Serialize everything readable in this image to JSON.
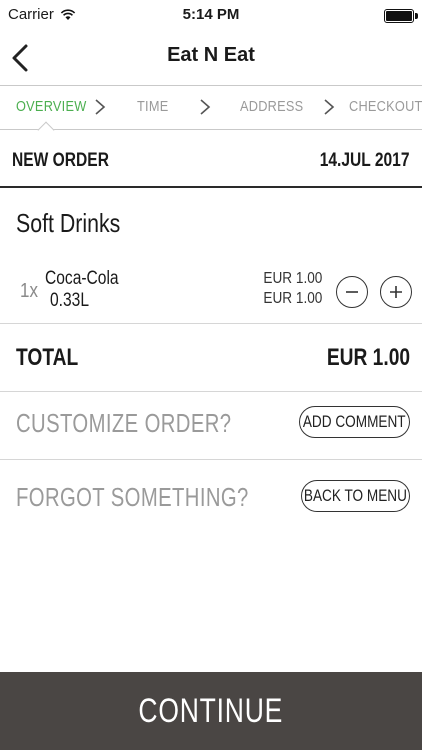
{
  "status_bar": {
    "carrier": "Carrier",
    "time": "5:14 PM",
    "battery_level": 1.0
  },
  "nav": {
    "title": "Eat N Eat",
    "back_icon": "chevron-left-icon"
  },
  "steps": [
    {
      "label": "OVERVIEW",
      "active": true
    },
    {
      "label": "TIME",
      "active": false
    },
    {
      "label": "ADDRESS",
      "active": false
    },
    {
      "label": "CHECKOUT",
      "active": false
    }
  ],
  "order": {
    "label": "NEW ORDER",
    "date": "14.JUL 2017"
  },
  "section": {
    "title": "Soft Drinks"
  },
  "items": [
    {
      "qty": "1x",
      "name": "Coca-Cola",
      "size": "0.33L",
      "unit_price": "EUR 1.00",
      "line_price": "EUR 1.00"
    }
  ],
  "total": {
    "label": "TOTAL",
    "value": "EUR 1.00"
  },
  "actions": {
    "customize_label": "CUSTOMIZE ORDER?",
    "add_comment_button": "ADD COMMENT",
    "forgot_label": "FORGOT SOMETHING?",
    "back_to_menu_button": "BACK TO MENU"
  },
  "continue_button": "CONTINUE",
  "colors": {
    "accent_green": "#4caf50",
    "continue_bg": "#4a4644",
    "muted_text": "#9a9a9a"
  }
}
